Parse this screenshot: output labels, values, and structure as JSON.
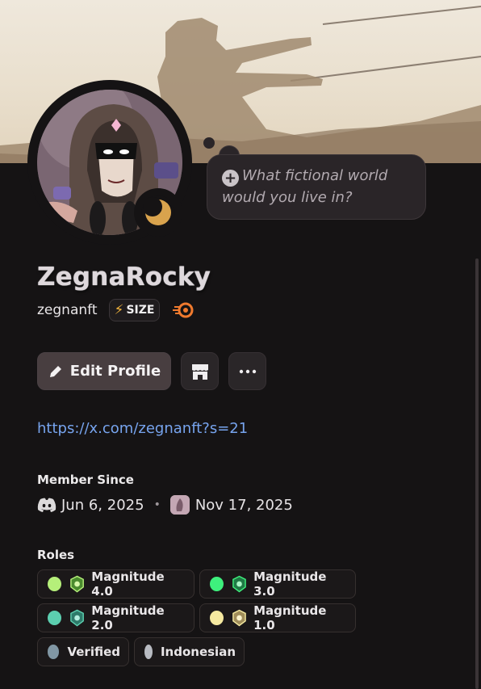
{
  "profile": {
    "display_name": "ZegnaRocky",
    "username": "zegnanft",
    "tag_label": "SIZE",
    "custom_status": "What fictional world would you live in?",
    "link": "https://x.com/zegnanft?s=21"
  },
  "actions": {
    "edit_label": "Edit Profile"
  },
  "member_since": {
    "label": "Member Since",
    "discord_date": "Jun 6, 2025",
    "server_date": "Nov 17, 2025"
  },
  "roles": {
    "label": "Roles",
    "items": [
      {
        "name": "Magnitude 4.0",
        "color": "#b5ef7a",
        "icon": "magnitude-badge-icon"
      },
      {
        "name": "Magnitude 3.0",
        "color": "#3ef07d",
        "icon": "magnitude-badge-icon"
      },
      {
        "name": "Magnitude 2.0",
        "color": "#5ccfb0",
        "icon": "magnitude-badge-icon"
      },
      {
        "name": "Magnitude 1.0",
        "color": "#f5e9a0",
        "icon": "magnitude-badge-icon"
      },
      {
        "name": "Verified",
        "color": "#8197a4"
      },
      {
        "name": "Indonesian",
        "color": "#b8bbc2"
      }
    ]
  },
  "colors": {
    "background": "#151314",
    "link": "#77a4ee",
    "edit_button": "#483e40",
    "status_moon": "#d9a34d",
    "tag_bolt": "#f0b23b",
    "nitro": "#f07a2e"
  }
}
